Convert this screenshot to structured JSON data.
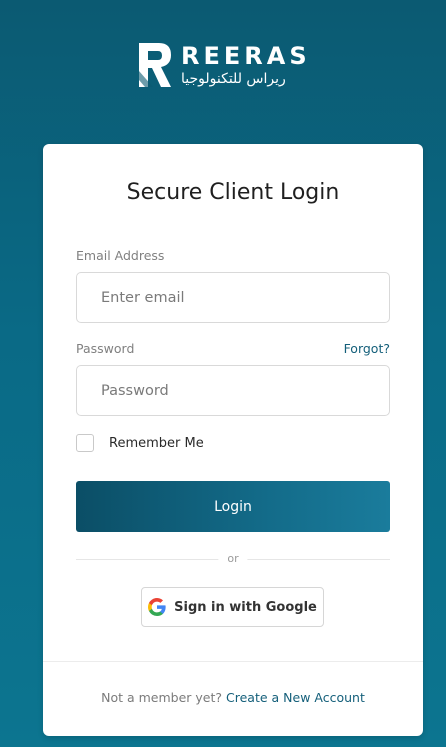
{
  "brand": {
    "name_en": "REERAS",
    "name_ar": "ريراس للتكنولوجيا",
    "logo_icon": "reeras-logo-mark"
  },
  "login": {
    "title": "Secure Client Login",
    "email": {
      "label": "Email Address",
      "placeholder": "Enter email",
      "value": ""
    },
    "password": {
      "label": "Password",
      "placeholder": "Password",
      "value": "",
      "forgot_label": "Forgot?"
    },
    "remember": {
      "label": "Remember Me",
      "checked": false
    },
    "submit_label": "Login",
    "divider_text": "or",
    "google": {
      "label": "Sign in with Google",
      "icon": "google-icon"
    },
    "signup": {
      "prompt": "Not a member yet?",
      "link_label": "Create a New Account"
    }
  },
  "colors": {
    "background": "#0b6480",
    "accent": "#145f7a",
    "button_gradient_start": "#0b4e66",
    "button_gradient_end": "#1a7c9c"
  }
}
